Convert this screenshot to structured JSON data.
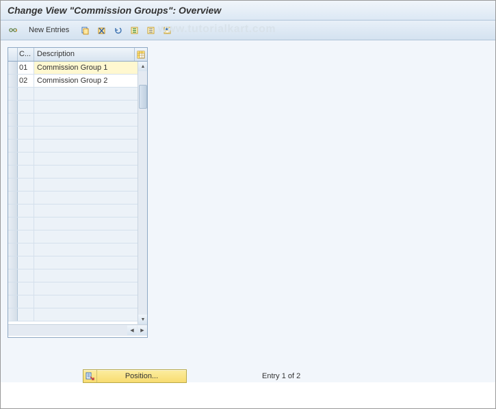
{
  "header": {
    "title": "Change View \"Commission Groups\": Overview"
  },
  "toolbar": {
    "new_entries_label": "New Entries"
  },
  "watermark": "www.tutorialkart.com",
  "table": {
    "columns": {
      "code": "C...",
      "description": "Description"
    },
    "rows": [
      {
        "code": "01",
        "description": "Commission Group 1",
        "highlight": true
      },
      {
        "code": "02",
        "description": "Commission Group 2",
        "highlight": false
      }
    ],
    "empty_row_count": 18
  },
  "footer": {
    "position_label": "Position...",
    "entry_text": "Entry 1 of 2"
  }
}
